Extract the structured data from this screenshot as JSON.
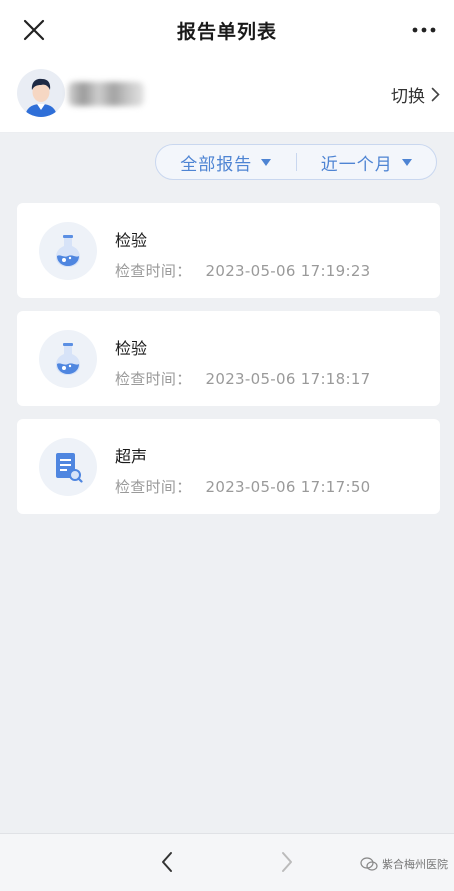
{
  "header": {
    "title": "报告单列表"
  },
  "user": {
    "switch_label": "切换"
  },
  "filter": {
    "type_label": "全部报告",
    "period_label": "近一个月"
  },
  "reports": [
    {
      "name": "检验",
      "time_label": "检查时间：",
      "time": "2023-05-06 17:19:23",
      "icon": "flask-icon"
    },
    {
      "name": "检验",
      "time_label": "检查时间：",
      "time": "2023-05-06 17:18:17",
      "icon": "flask-icon"
    },
    {
      "name": "超声",
      "time_label": "检查时间：",
      "time": "2023-05-06 17:17:50",
      "icon": "document-search-icon"
    }
  ],
  "footer": {
    "watermark": "紫合梅州医院"
  },
  "colors": {
    "accent": "#4e84d3",
    "background": "#eef0f3",
    "card": "#ffffff"
  }
}
